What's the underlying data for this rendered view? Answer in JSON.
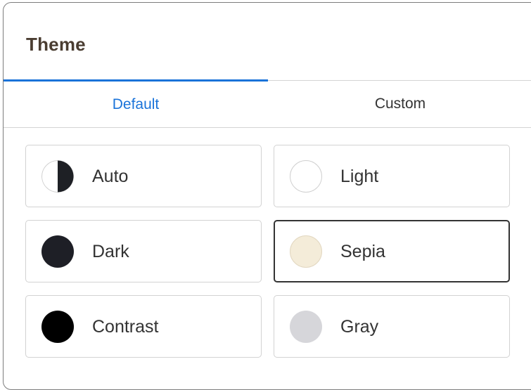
{
  "header": {
    "title": "Theme"
  },
  "tabs": [
    {
      "label": "Default",
      "active": true
    },
    {
      "label": "Custom",
      "active": false
    }
  ],
  "themes": [
    {
      "label": "Auto",
      "swatch": "half-dark-half-light",
      "color": "#1e2025",
      "selected": false
    },
    {
      "label": "Light",
      "swatch": "solid",
      "color": "#ffffff",
      "selected": false
    },
    {
      "label": "Dark",
      "swatch": "solid",
      "color": "#1e1f26",
      "selected": false
    },
    {
      "label": "Sepia",
      "swatch": "solid",
      "color": "#f4ecd9",
      "selected": true
    },
    {
      "label": "Contrast",
      "swatch": "solid",
      "color": "#000000",
      "selected": false
    },
    {
      "label": "Gray",
      "swatch": "solid",
      "color": "#d6d6da",
      "selected": false
    }
  ],
  "colors": {
    "accent": "#1a73d9",
    "title": "#4a3d31",
    "text": "#333333"
  }
}
